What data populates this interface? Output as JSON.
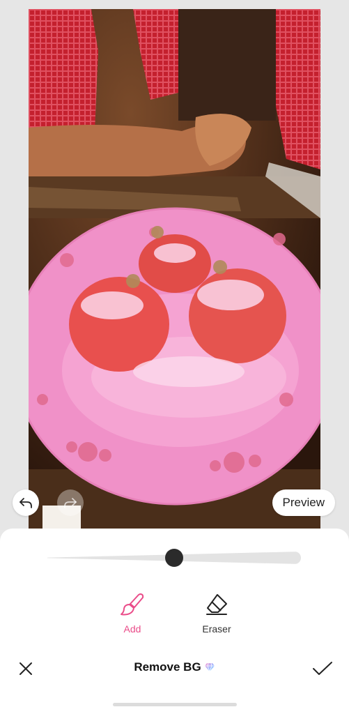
{
  "canvas": {
    "preview_label": "Preview",
    "undo_icon": "undo-arrow-icon",
    "redo_icon": "redo-arrow-icon",
    "redo_enabled": false
  },
  "brush_slider": {
    "level": 0.5
  },
  "tools": {
    "add": {
      "label": "Add",
      "icon": "brush-icon",
      "active": true
    },
    "eraser": {
      "label": "Eraser",
      "icon": "eraser-icon",
      "active": false
    }
  },
  "footer": {
    "title": "Remove BG",
    "premium_icon": "premium-gem-icon",
    "close_icon": "close-icon",
    "done_icon": "checkmark-icon"
  },
  "colors": {
    "accent": "#ea4c89",
    "mask_overlay": "#f090c8",
    "slider_thumb": "#2b2b2b"
  }
}
